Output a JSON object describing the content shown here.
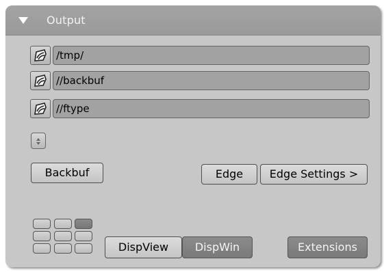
{
  "panel": {
    "title": "Output",
    "collapse_icon": "triangle-down-icon"
  },
  "paths": [
    {
      "icon": "folder-browse-icon",
      "value": "/tmp/"
    },
    {
      "icon": "folder-browse-icon",
      "value": "//backbuf"
    },
    {
      "icon": "folder-browse-icon",
      "value": "//ftype"
    }
  ],
  "stepper": {
    "icon": "up-down-arrows-icon"
  },
  "buttons": {
    "backbuf": "Backbuf",
    "edge": "Edge",
    "edge_settings": "Edge Settings >",
    "dispview": "DispView",
    "dispwin": "DispWin",
    "extensions": "Extensions"
  },
  "toggle_state": {
    "dispwin_active": true,
    "extensions_active": true
  },
  "grid": {
    "icon": "screen-layout-grid-icon",
    "rows": 3,
    "cols": 3,
    "active_cell": "top-right"
  },
  "colors": {
    "panel_bg": "#c7c7c7",
    "header_bg": "#a0a0a0",
    "field_bg": "#a2a2a2",
    "active_button": "#808080"
  }
}
